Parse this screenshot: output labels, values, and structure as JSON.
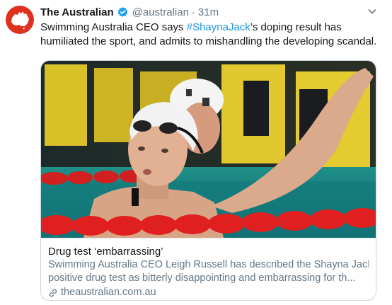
{
  "tweet": {
    "display_name": "The Australian",
    "handle": "@australian",
    "separator": "·",
    "time": "31m",
    "text_before": "Swimming Australia CEO says ",
    "hashtag": "#ShaynaJack",
    "text_after": "’s doping result has humiliated the sport, and admits to mishandling the developing scandal."
  },
  "card": {
    "title": "Drug test ‘embarrassing’",
    "description_line1": "Swimming Australia CEO Leigh Russell has described the Shayna Jack",
    "description_line2": "positive drug test as bitterly disappointing and embarrassing for th...",
    "domain": "theaustralian.com.au"
  },
  "icons": {
    "avatar": "australia-map-logo",
    "verified": "verified-badge-icon",
    "menu": "chevron-down-icon",
    "link": "link-icon"
  },
  "colors": {
    "avatar_bg": "#e0301e",
    "hashtag": "#1b95e0",
    "verified": "#1da1f2",
    "secondary_text": "#657786"
  }
}
